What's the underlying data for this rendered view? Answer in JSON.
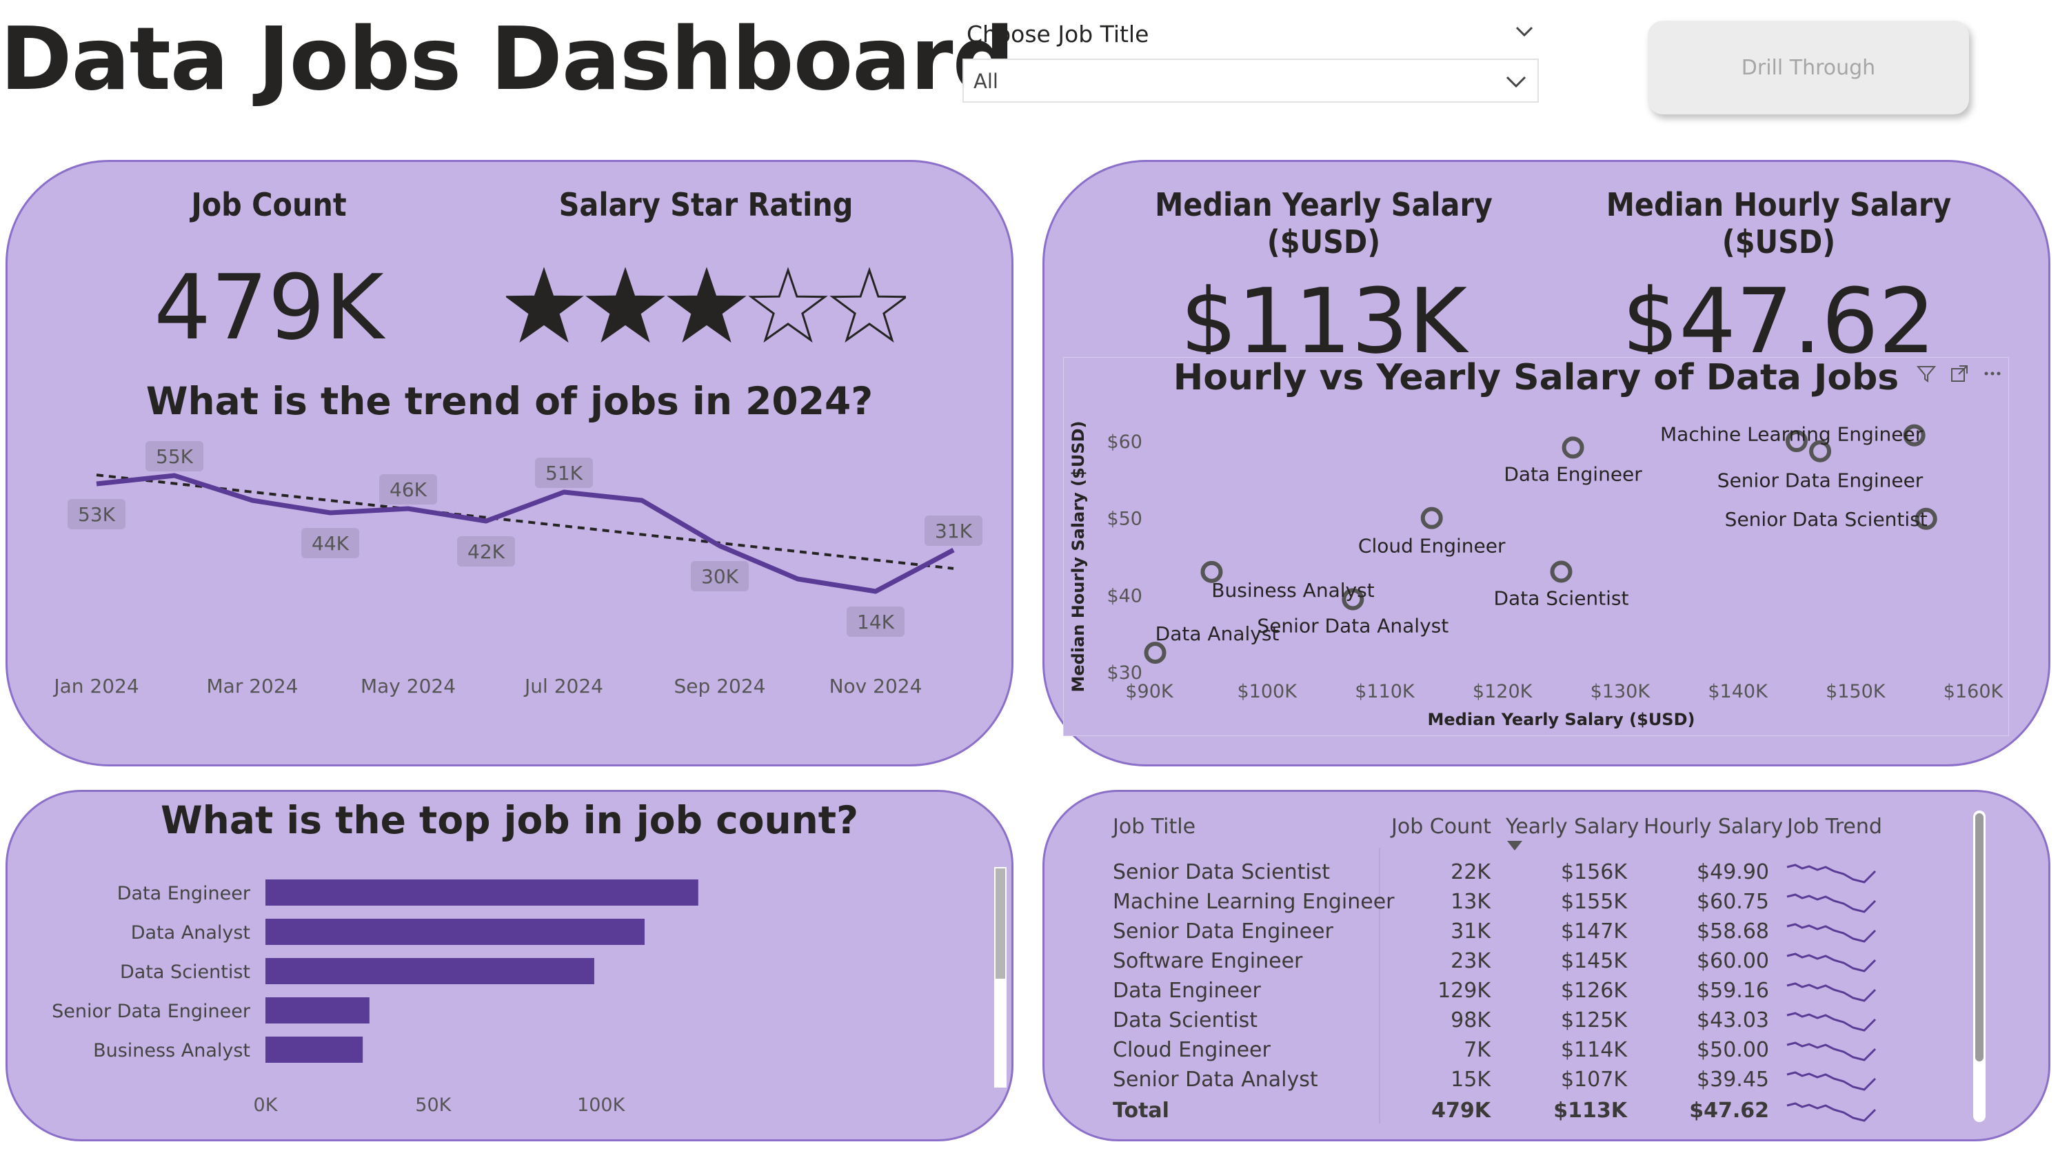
{
  "header": {
    "title": "Data Jobs Dashboard",
    "slicer_label": "Choose Job Title",
    "slicer_value": "All",
    "drill_button": "Drill Through"
  },
  "kpis": {
    "job_count_label": "Job Count",
    "job_count_value": "479K",
    "star_label": "Salary Star Rating",
    "star_rating": 3,
    "star_max": 5,
    "yearly_label_1": "Median Yearly Salary",
    "yearly_label_2": "($USD)",
    "yearly_value": "$113K",
    "hourly_label_1": "Median Hourly Salary",
    "hourly_label_2": "($USD)",
    "hourly_value": "$47.62"
  },
  "colors": {
    "panel": "#c5b3e5",
    "panel_border": "#8b6fc9",
    "accent": "#5a3b96"
  },
  "chart_data": [
    {
      "type": "line",
      "title": "What is the trend of jobs in 2024?",
      "x": [
        "Jan 2024",
        "Feb 2024",
        "Mar 2024",
        "Apr 2024",
        "May 2024",
        "Jun 2024",
        "Jul 2024",
        "Aug 2024",
        "Sep 2024",
        "Oct 2024",
        "Nov 2024",
        "Dec 2024"
      ],
      "x_tick_labels": [
        "Jan 2024",
        "Mar 2024",
        "May 2024",
        "Jul 2024",
        "Sep 2024",
        "Nov 2024"
      ],
      "series": [
        {
          "values": [
            53,
            55,
            49,
            46,
            47,
            44,
            51,
            49,
            38,
            30,
            27,
            37
          ]
        }
      ],
      "data_labels": [
        {
          "index": 0,
          "text": "53K"
        },
        {
          "index": 1,
          "text": "55K"
        },
        {
          "index": 3,
          "text": "44K"
        },
        {
          "index": 4,
          "text": "46K"
        },
        {
          "index": 5,
          "text": "42K"
        },
        {
          "index": 6,
          "text": "51K"
        },
        {
          "index": 8,
          "text": "30K"
        },
        {
          "index": 10,
          "text": "14K"
        },
        {
          "index": 11,
          "text": "31K"
        }
      ],
      "trendline": true
    },
    {
      "type": "scatter",
      "title": "Hourly vs Yearly Salary of Data Jobs",
      "xlabel": "Median Yearly Salary ($USD)",
      "ylabel": "Median Hourly Salary ($USD)",
      "xlim": [
        90,
        160
      ],
      "ylim": [
        30,
        60
      ],
      "x_ticks": [
        "$90K",
        "$100K",
        "$110K",
        "$120K",
        "$130K",
        "$140K",
        "$150K",
        "$160K"
      ],
      "y_ticks": [
        "$30",
        "$40",
        "$50",
        "$60"
      ],
      "points": [
        {
          "label": "Data Analyst",
          "x": 90.5,
          "y": 32.5
        },
        {
          "label": "Business Analyst",
          "x": 95.3,
          "y": 43.0
        },
        {
          "label": "Senior Data Analyst",
          "x": 107.3,
          "y": 39.45
        },
        {
          "label": "Cloud Engineer",
          "x": 114.0,
          "y": 50.0
        },
        {
          "label": "Data Scientist",
          "x": 125.0,
          "y": 43.03
        },
        {
          "label": "Data Engineer",
          "x": 126.0,
          "y": 59.16
        },
        {
          "label": "Software Engineer",
          "x": 145.0,
          "y": 60.0
        },
        {
          "label": "Senior Data Engineer",
          "x": 147.0,
          "y": 58.68
        },
        {
          "label": "Machine Learning Engineer",
          "x": 155.0,
          "y": 60.75
        },
        {
          "label": "Senior Data Scientist",
          "x": 156.0,
          "y": 49.9
        }
      ],
      "shown_labels": [
        "Data Engineer",
        "Machine Learning Engineer",
        "Senior Data Engineer",
        "Cloud Engineer",
        "Senior Data Scientist",
        "Business Analyst",
        "Data Scientist",
        "Data Analyst",
        "Senior Data Analyst"
      ]
    },
    {
      "type": "bar",
      "title": "What is the top job in job count?",
      "categories": [
        "Data Engineer",
        "Data Analyst",
        "Data Scientist",
        "Senior Data Engineer",
        "Business Analyst"
      ],
      "values": [
        129,
        113,
        98,
        31,
        29
      ],
      "x_ticks": [
        "0K",
        "50K",
        "100K"
      ],
      "xlim": [
        0,
        150
      ]
    }
  ],
  "table": {
    "headers": [
      "Job Title",
      "Job Count",
      "Yearly Salary",
      "Hourly Salary",
      "Job Trend"
    ],
    "rows": [
      {
        "title": "Senior Data Scientist",
        "count": "22K",
        "yearly": "$156K",
        "hourly": "$49.90"
      },
      {
        "title": "Machine Learning Engineer",
        "count": "13K",
        "yearly": "$155K",
        "hourly": "$60.75"
      },
      {
        "title": "Senior Data Engineer",
        "count": "31K",
        "yearly": "$147K",
        "hourly": "$58.68"
      },
      {
        "title": "Software Engineer",
        "count": "23K",
        "yearly": "$145K",
        "hourly": "$60.00"
      },
      {
        "title": "Data Engineer",
        "count": "129K",
        "yearly": "$126K",
        "hourly": "$59.16"
      },
      {
        "title": "Data Scientist",
        "count": "98K",
        "yearly": "$125K",
        "hourly": "$43.03"
      },
      {
        "title": "Cloud Engineer",
        "count": "7K",
        "yearly": "$114K",
        "hourly": "$50.00"
      },
      {
        "title": "Senior Data Analyst",
        "count": "15K",
        "yearly": "$107K",
        "hourly": "$39.45"
      }
    ],
    "total": {
      "title": "Total",
      "count": "479K",
      "yearly": "$113K",
      "hourly": "$47.62"
    }
  }
}
